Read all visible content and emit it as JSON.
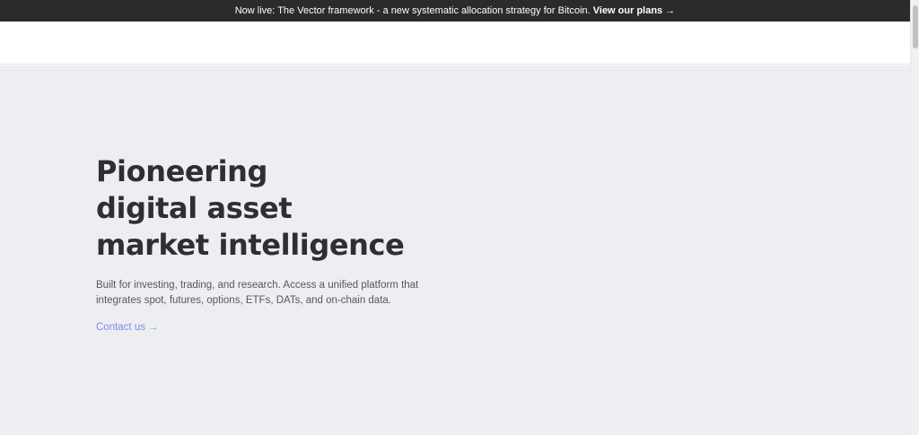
{
  "announcement": {
    "text": "Now live: The Vector framework - a new systematic allocation strategy for Bitcoin.",
    "cta": "View our plans →"
  },
  "hero": {
    "title_lines": [
      "Pioneering",
      "digital asset",
      "market intelligence"
    ],
    "description": "Built for investing, trading, and research. Access a unified platform that integrates spot, futures, options, ETFs, DATs, and on-chain data.",
    "contact_link": "Contact us →"
  },
  "colors": {
    "announce_bg": "#2b2b2b",
    "hero_bg": "#edeef1",
    "heading": "#2f2f33",
    "link": "#7b8ce6"
  }
}
